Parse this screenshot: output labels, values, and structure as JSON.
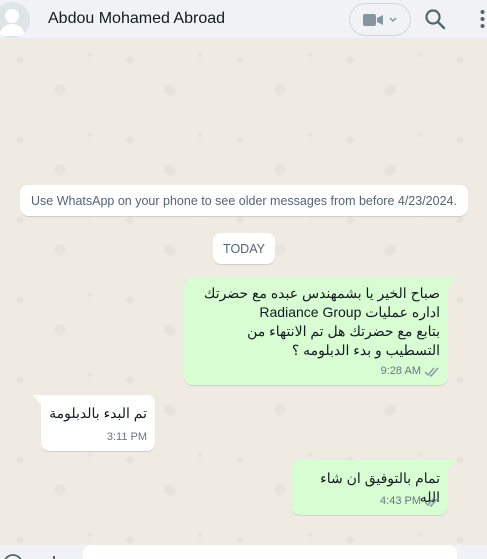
{
  "header": {
    "contact_name": "Abdou Mohamed Abroad",
    "icons": {
      "avatar": "default-user-avatar",
      "video": "video-camera-icon",
      "dropdown": "chevron-down-icon",
      "search": "search-icon",
      "menu": "kebab-menu-icon"
    }
  },
  "chat": {
    "system_note": "Use WhatsApp on your phone to see older messages from before 4/23/2024.",
    "date_chip": "TODAY",
    "messages": [
      {
        "direction": "outgoing",
        "text": "صباح الخير يا بشمهندس عبده مع  حضرتك\nاداره عمليات Radiance Group\nبتابع مع حضرتك هل تم الانتهاء من\nالتسطيب و بدء الدبلومه ؟",
        "time": "9:28 AM",
        "status": "double-check-icon"
      },
      {
        "direction": "incoming",
        "text": "تم البدء بالدبلومة",
        "time": "3:11 PM"
      },
      {
        "direction": "outgoing",
        "text": "تمام بالتوفيق ان شاء الله",
        "time": "4:43 PM",
        "status": "double-check-icon"
      }
    ]
  },
  "composer": {
    "icons": {
      "emoji": "emoji-icon",
      "attach": "plus-icon"
    },
    "placeholder": ""
  },
  "colors": {
    "outgoing_bubble": "#d9fdd3",
    "incoming_bubble": "#ffffff",
    "chat_background": "#efeae2",
    "header_background": "#f0f2f5",
    "read_tick": "#8696a0"
  }
}
